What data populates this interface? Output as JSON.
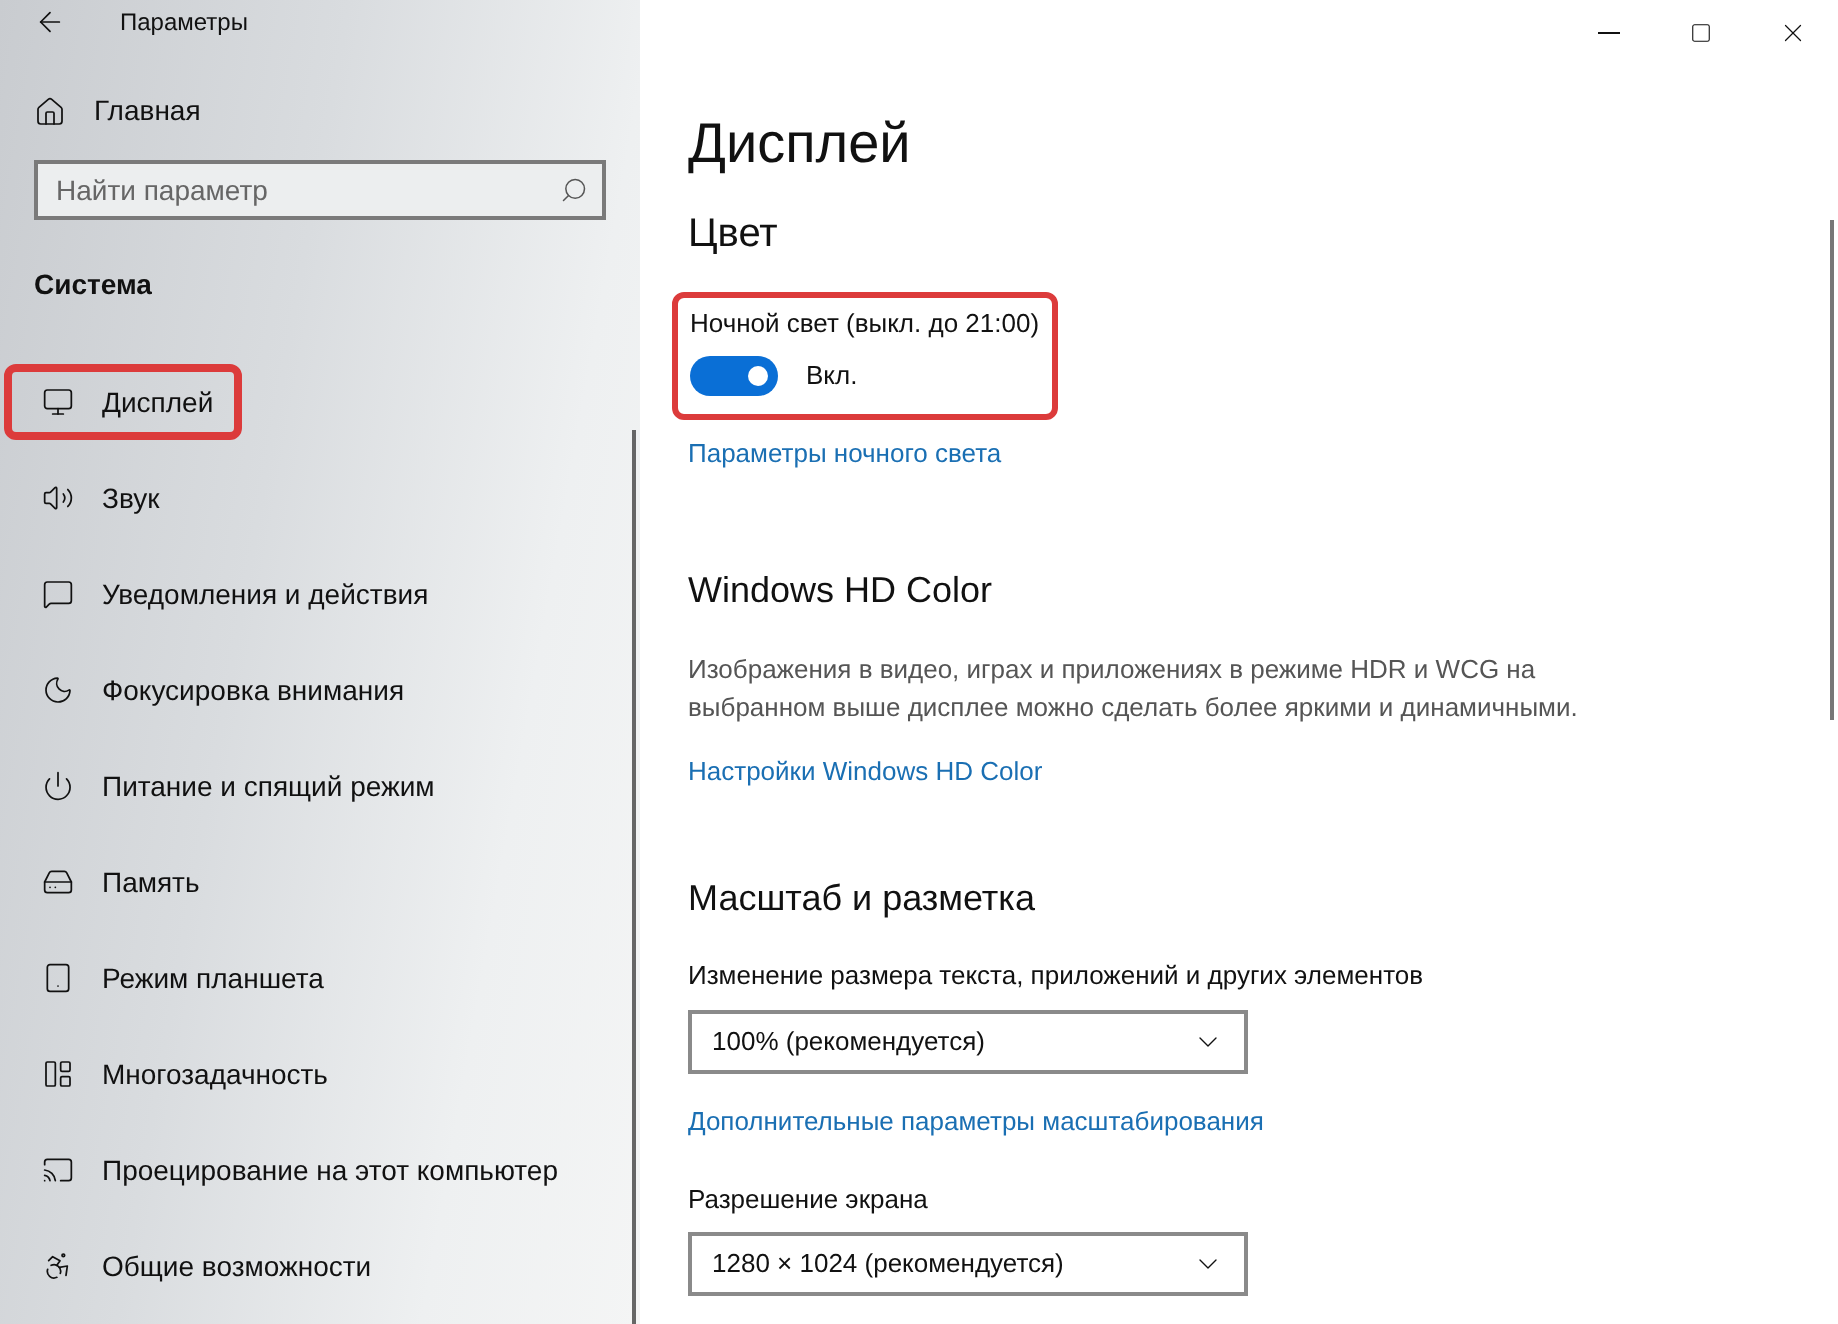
{
  "window": {
    "title": "Параметры"
  },
  "sidebar": {
    "home": "Главная",
    "search": {
      "placeholder": "Найти параметр"
    },
    "section": "Система",
    "items": [
      {
        "label": "Дисплей",
        "highlighted": true
      },
      {
        "label": "Звук",
        "highlighted": false
      },
      {
        "label": "Уведомления и действия",
        "highlighted": false
      },
      {
        "label": "Фокусировка внимания",
        "highlighted": false
      },
      {
        "label": "Питание и спящий режим",
        "highlighted": false
      },
      {
        "label": "Память",
        "highlighted": false
      },
      {
        "label": "Режим планшета",
        "highlighted": false
      },
      {
        "label": "Многозадачность",
        "highlighted": false
      },
      {
        "label": "Проецирование на этот компьютер",
        "highlighted": false
      },
      {
        "label": "Общие возможности",
        "highlighted": false
      }
    ]
  },
  "page": {
    "title": "Дисплей",
    "color": {
      "heading": "Цвет",
      "night_light": {
        "label": "Ночной свет (выкл. до 21:00)",
        "on": true,
        "state_text": "Вкл.",
        "highlighted": true
      },
      "link": "Параметры ночного света"
    },
    "hd_color": {
      "heading": "Windows HD Color",
      "description": "Изображения в видео, играх и приложениях в режиме HDR и WCG на выбранном выше дисплее можно сделать более яркими и динамичными.",
      "link": "Настройки Windows HD Color"
    },
    "scale": {
      "heading": "Масштаб и разметка",
      "size_label": "Изменение размера текста, приложений и других элементов",
      "size_value": "100% (рекомендуется)",
      "link": "Дополнительные параметры масштабирования",
      "resolution_label": "Разрешение экрана",
      "resolution_value": "1280 × 1024 (рекомендуется)"
    }
  }
}
